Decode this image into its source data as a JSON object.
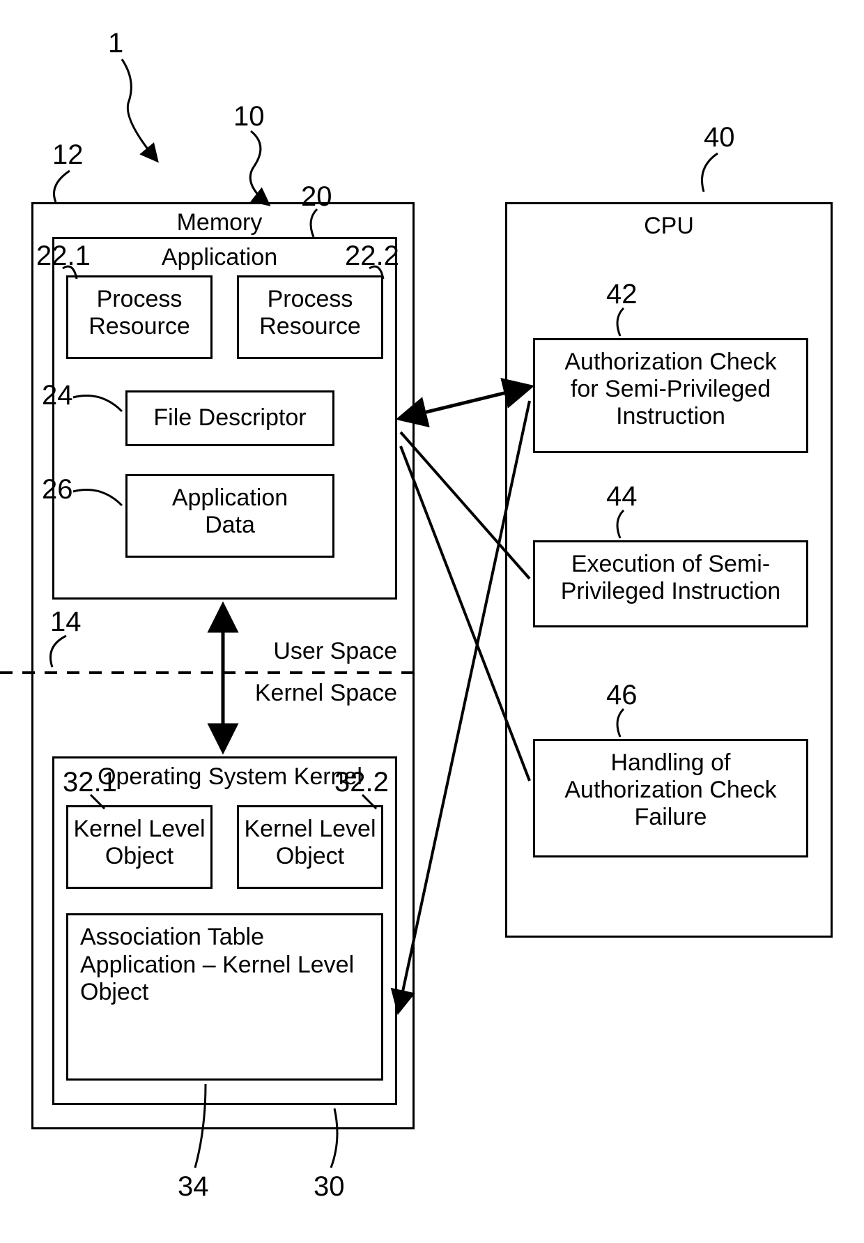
{
  "refs": {
    "r1": "1",
    "r10": "10",
    "r12": "12",
    "r14": "14",
    "r20": "20",
    "r22_1": "22.1",
    "r22_2": "22.2",
    "r24": "24",
    "r26": "26",
    "r30": "30",
    "r32_1": "32.1",
    "r32_2": "32.2",
    "r34": "34",
    "r40": "40",
    "r42": "42",
    "r44": "44",
    "r46": "46"
  },
  "labels": {
    "memory_title": "Memory",
    "application_title": "Application",
    "process_resource": "Process\nResource",
    "file_descriptor": "File Descriptor",
    "application_data": "Application\nData",
    "user_space": "User Space",
    "kernel_space": "Kernel Space",
    "os_kernel_title": "Operating System Kernel",
    "kernel_level_object": "Kernel Level\nObject",
    "assoc_table_line1": "Association Table",
    "assoc_table_line2": "Application – Kernel Level Object",
    "cpu_title": "CPU",
    "auth_check": "Authorization Check\nfor Semi-Privileged\nInstruction",
    "exec_semi": "Execution of Semi-\nPrivileged Instruction",
    "handle_fail": "Handling of\nAuthorization Check\nFailure"
  }
}
